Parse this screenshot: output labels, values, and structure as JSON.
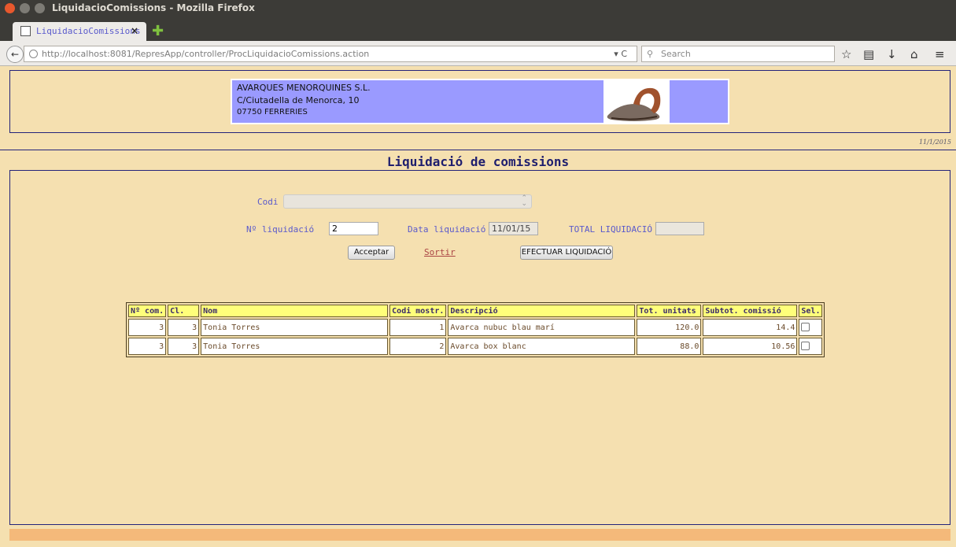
{
  "window": {
    "title": "LiquidacioComissions - Mozilla Firefox"
  },
  "browser": {
    "tab_label": "LiquidacioComissions",
    "url": "http://localhost:8081/RepresApp/controller/ProcLiquidacioComissions.action",
    "search_placeholder": "Search"
  },
  "header": {
    "company_line1": "AVARQUES MENORQUINES S.L.",
    "company_line2": "C/Ciutadella de Menorca, 10",
    "company_line3": "07750 FERRERIES",
    "date": "11/1/2015"
  },
  "page_title": "Liquidació de comissions",
  "form": {
    "codi_label": "Codi",
    "num_liquidacio_label": "Nº liquidació",
    "num_liquidacio_value": "2",
    "data_liquidacio_label": "Data liquidació",
    "data_liquidacio_value": "11/01/15",
    "total_label": "TOTAL LIQUIDACIÓ",
    "total_value": "",
    "accept_label": "Acceptar",
    "exit_label": "Sortir",
    "execute_label": "EFECTUAR LIQUIDACIÓ"
  },
  "table": {
    "headers": [
      "Nº com.",
      "Cl.",
      "Nom",
      "Codi mostr.",
      "Descripció",
      "Tot. unitats",
      "Subtot. comissió",
      "Sel."
    ],
    "rows": [
      [
        "3",
        "3",
        "Tonia Torres",
        "1",
        "Avarca nubuc blau marí",
        "120.0",
        "14.4",
        ""
      ],
      [
        "3",
        "3",
        "Tonia Torres",
        "2",
        "Avarca box blanc",
        "88.0",
        "10.56",
        ""
      ]
    ]
  },
  "icons": [
    "close-icon",
    "minimize-icon",
    "maximize-icon",
    "favicon-icon",
    "new-tab-icon",
    "back-icon",
    "globe-icon",
    "reload-icon",
    "search-icon",
    "bookmark-star-icon",
    "reading-list-icon",
    "download-icon",
    "home-icon",
    "menu-icon",
    "sandal-image"
  ],
  "colors": {
    "page_bg": "#f5e0b0",
    "logo_bg": "#9a9aff",
    "header_cells": "#ffff7a",
    "border_blue": "#23237a",
    "footer": "#f4b97a"
  }
}
